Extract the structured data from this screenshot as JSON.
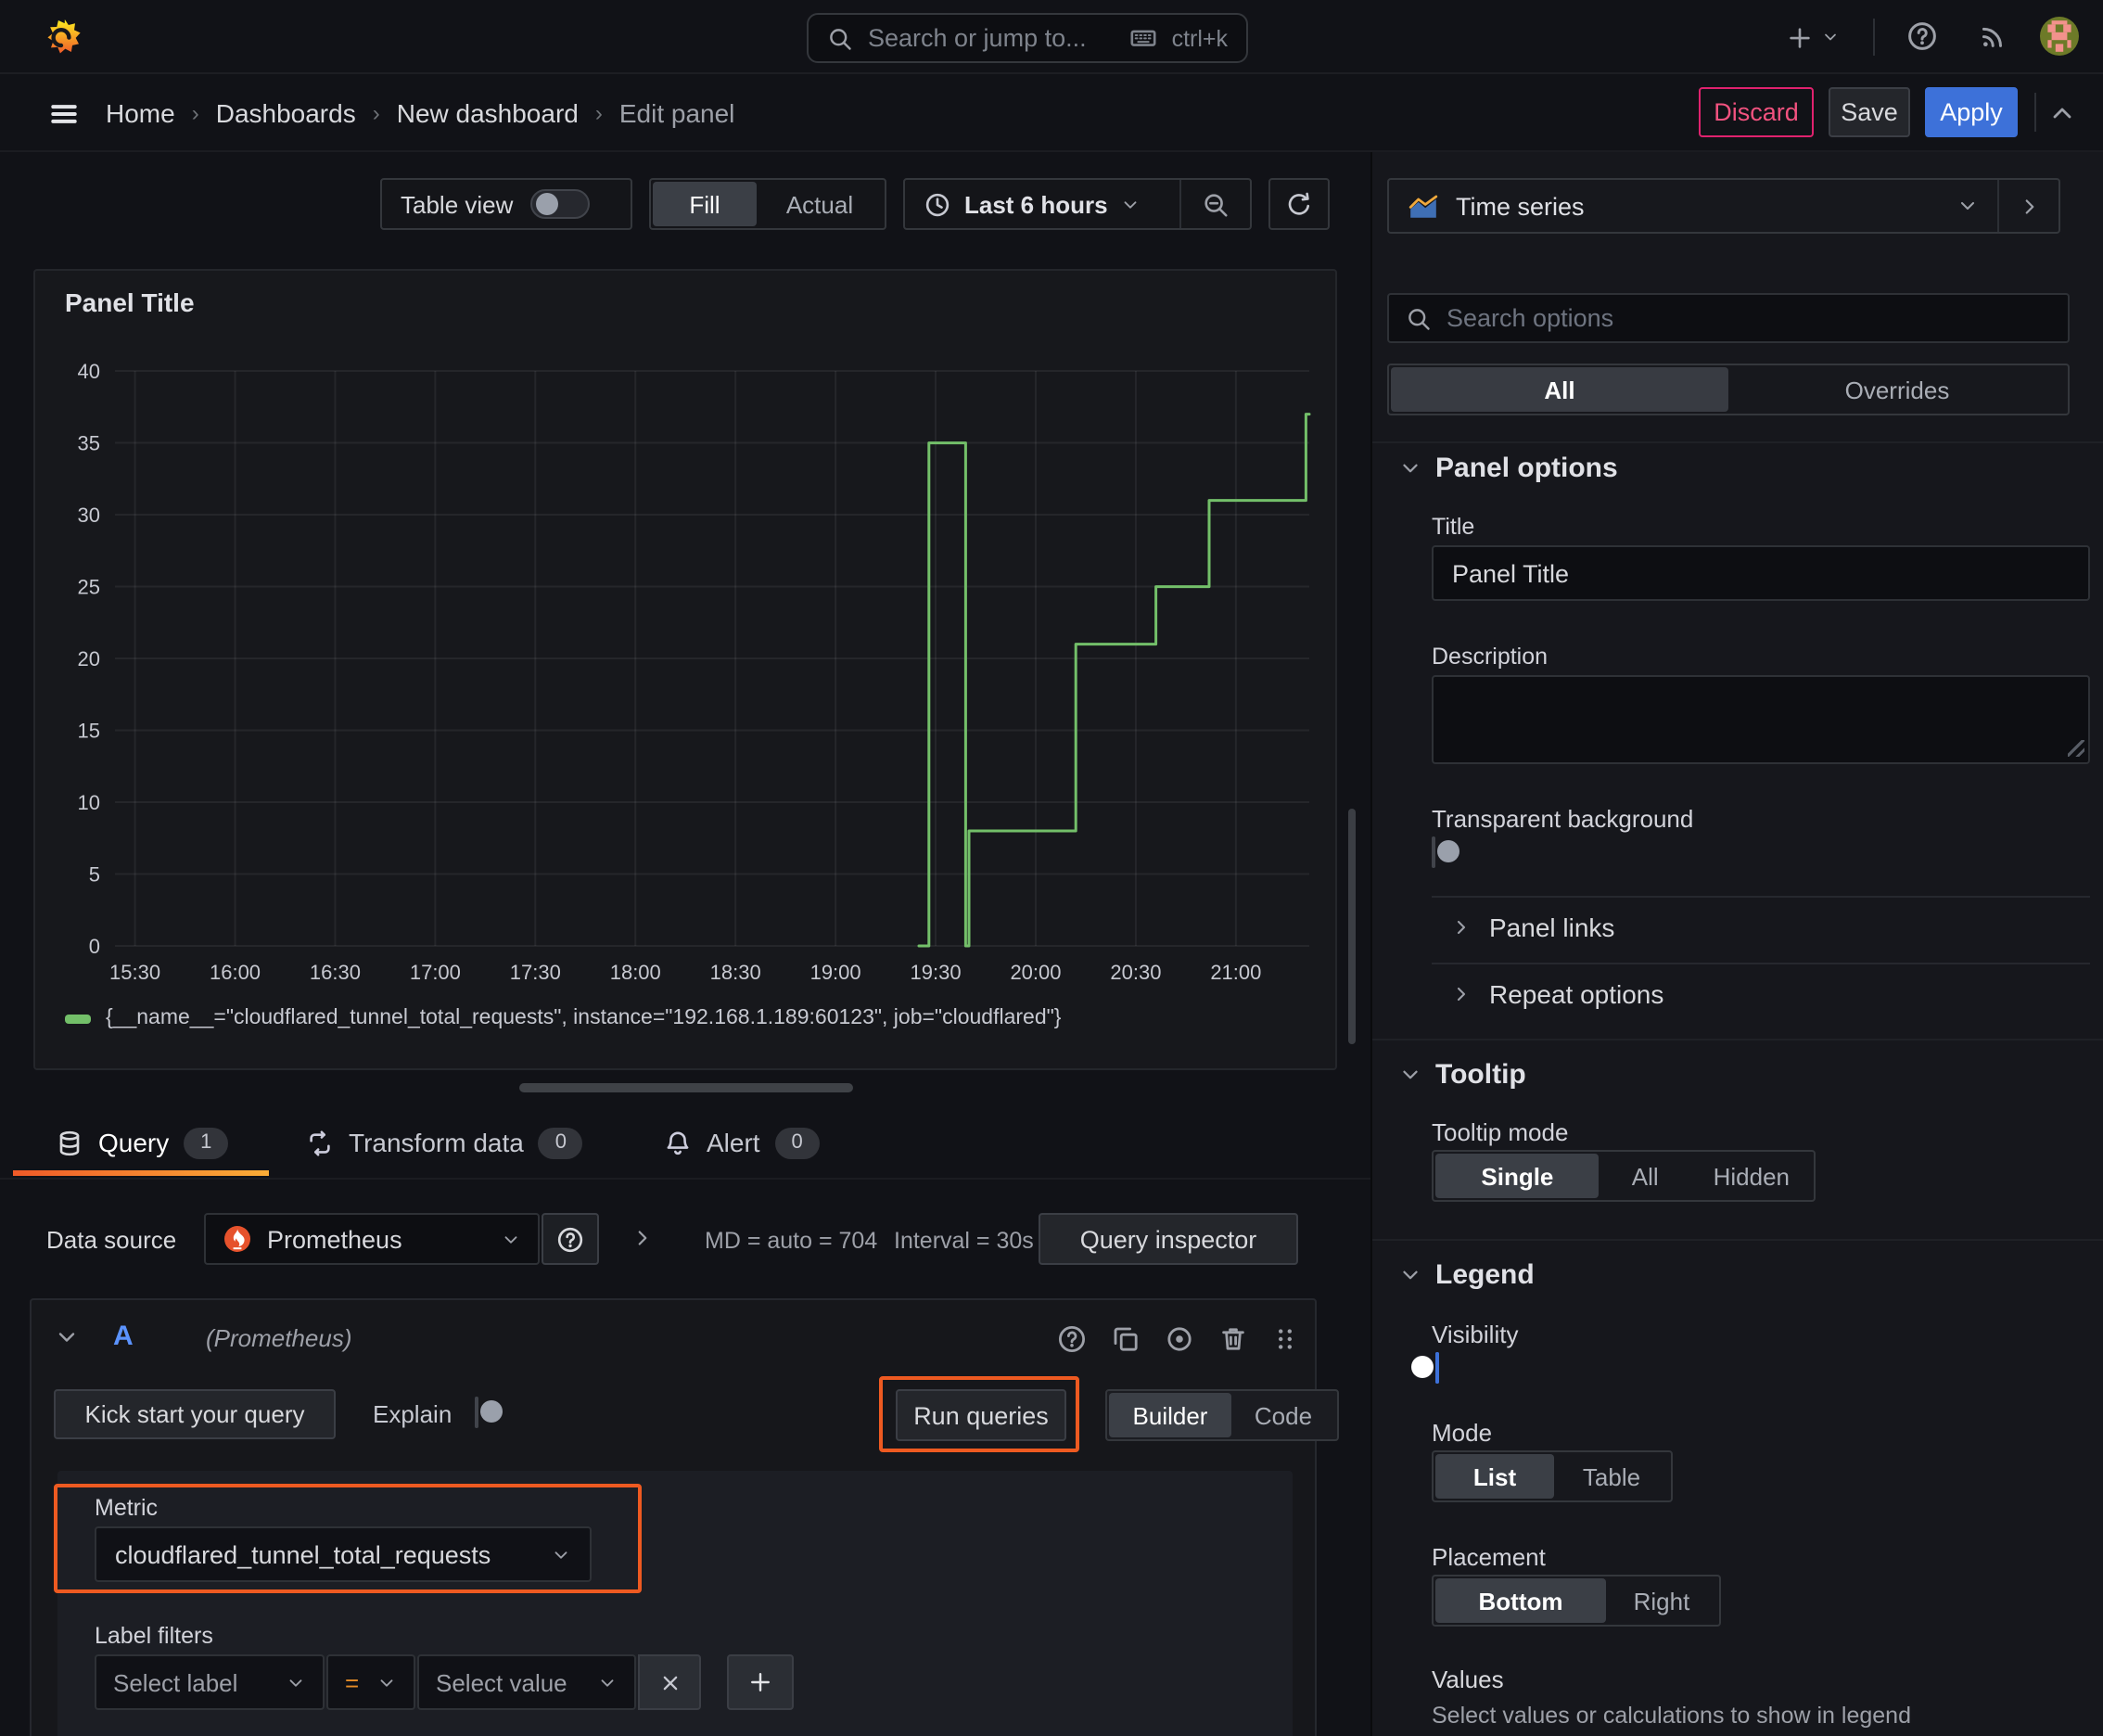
{
  "colors": {
    "series_green": "#73bf69",
    "primary_blue": "#3d71d9",
    "destructive_pink": "#f2527f",
    "annotation_orange": "#ee5a21",
    "tab_accent": "#ff780a",
    "operator_orange": "#e58c27"
  },
  "topbar": {
    "search_placeholder": "Search or jump to...",
    "search_shortcut": "ctrl+k"
  },
  "breadcrumb": {
    "separator": "›",
    "items": [
      "Home",
      "Dashboards",
      "New dashboard",
      "Edit panel"
    ]
  },
  "header_actions": {
    "discard": "Discard",
    "save": "Save",
    "apply": "Apply"
  },
  "panel_toolbar": {
    "table_view": "Table view",
    "fill": "Fill",
    "actual": "Actual",
    "time_range": "Last 6 hours"
  },
  "panel": {
    "title": "Panel Title"
  },
  "chart_data": {
    "type": "line",
    "title": "Panel Title",
    "line_interpolation": "step-after",
    "grid": true,
    "legend_position": "bottom",
    "xlabel": "",
    "ylabel": "",
    "x_domain": [
      "15:24",
      "21:22"
    ],
    "y_domain": [
      0,
      40
    ],
    "x_ticks": [
      "15:30",
      "16:00",
      "16:30",
      "17:00",
      "17:30",
      "18:00",
      "18:30",
      "19:00",
      "19:30",
      "20:00",
      "20:30",
      "21:00"
    ],
    "y_ticks": [
      0,
      5,
      10,
      15,
      20,
      25,
      30,
      35,
      40
    ],
    "series": [
      {
        "name": "{__name__=\"cloudflared_tunnel_total_requests\", instance=\"192.168.1.189:60123\", job=\"cloudflared\"}",
        "color": "#73bf69",
        "points": [
          [
            "19:25",
            0
          ],
          [
            "19:28",
            35
          ],
          [
            "19:39",
            0
          ],
          [
            "19:40",
            8
          ],
          [
            "20:12",
            21
          ],
          [
            "20:36",
            25
          ],
          [
            "20:52",
            31
          ],
          [
            "21:21",
            37
          ],
          [
            "21:22",
            37
          ]
        ]
      }
    ]
  },
  "tabs": {
    "query": "Query",
    "query_count": "1",
    "transform": "Transform data",
    "transform_count": "0",
    "alert": "Alert",
    "alert_count": "0"
  },
  "datasource": {
    "label": "Data source",
    "selected": "Prometheus",
    "max_data_points": "MD = auto = 704",
    "interval": "Interval = 30s",
    "inspector": "Query inspector"
  },
  "query": {
    "ref_id": "A",
    "ds_hint": "(Prometheus)",
    "kickstart": "Kick start your query",
    "explain": "Explain",
    "run": "Run queries",
    "builder": "Builder",
    "code": "Code",
    "metric_label": "Metric",
    "metric_value": "cloudflared_tunnel_total_requests",
    "label_filters": "Label filters",
    "select_label": "Select label",
    "operator": "=",
    "select_value": "Select value"
  },
  "sidebar": {
    "viz_type": "Time series",
    "search_placeholder": "Search options",
    "tab_all": "All",
    "tab_overrides": "Overrides",
    "panel_options": {
      "heading": "Panel options",
      "title_label": "Title",
      "title_value": "Panel Title",
      "description_label": "Description",
      "transparent_label": "Transparent background"
    },
    "panel_links": "Panel links",
    "repeat_options": "Repeat options",
    "tooltip": {
      "heading": "Tooltip",
      "mode_label": "Tooltip mode",
      "modes": [
        "Single",
        "All",
        "Hidden"
      ]
    },
    "legend": {
      "heading": "Legend",
      "visibility_label": "Visibility",
      "mode_label": "Mode",
      "modes": [
        "List",
        "Table"
      ],
      "placement_label": "Placement",
      "placements": [
        "Bottom",
        "Right"
      ],
      "values_label": "Values",
      "values_hint": "Select values or calculations to show in legend"
    }
  }
}
